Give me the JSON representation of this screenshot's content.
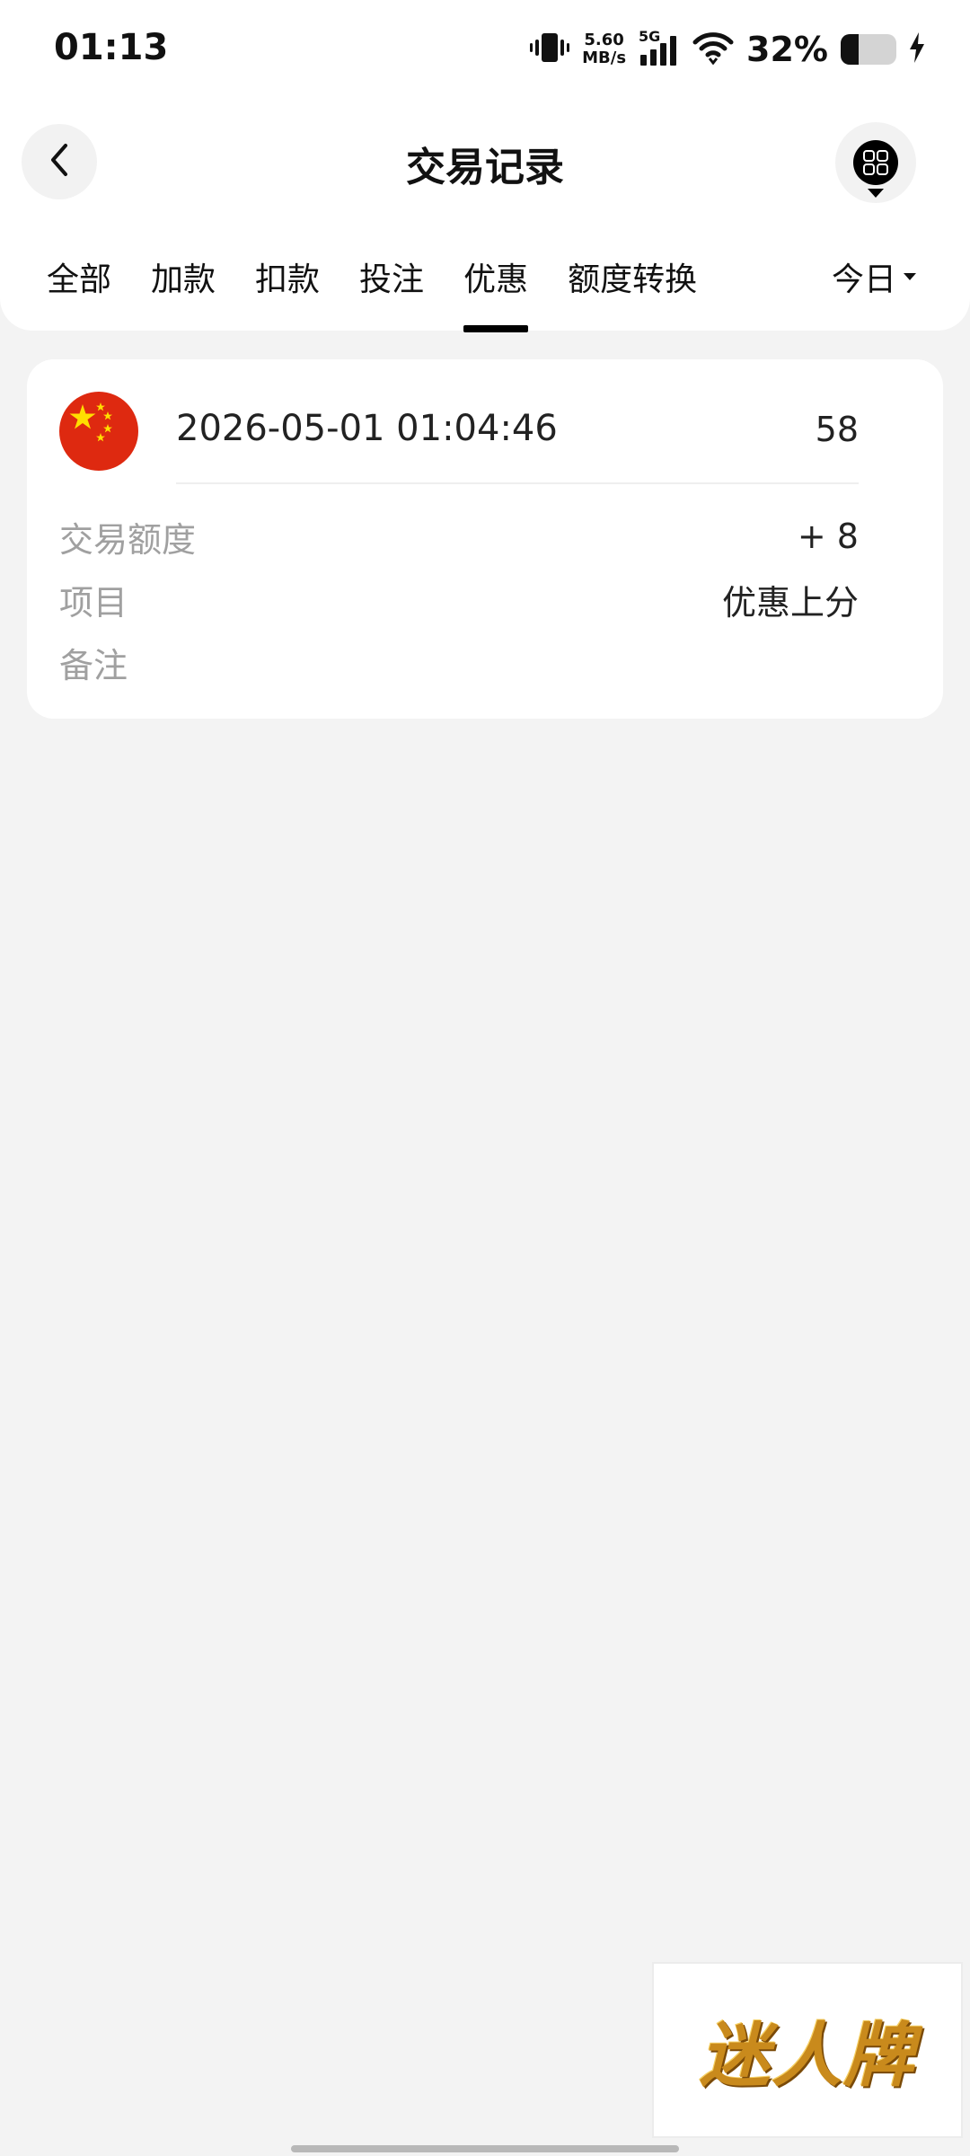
{
  "status_bar": {
    "time": "01:13",
    "net_speed_value": "5.60",
    "net_speed_unit": "MB/s",
    "network": "5G",
    "battery_percent": "32%",
    "battery_level": 0.32,
    "icons": [
      "vibrate-icon",
      "signal-icon",
      "wifi-icon",
      "battery-icon",
      "charging-icon"
    ]
  },
  "header": {
    "title": "交易记录",
    "back_icon": "chevron-left-icon",
    "menu_icon": "grid-menu-icon"
  },
  "tabs": {
    "items": [
      {
        "label": "全部"
      },
      {
        "label": "加款"
      },
      {
        "label": "扣款"
      },
      {
        "label": "投注"
      },
      {
        "label": "优惠"
      },
      {
        "label": "额度转换"
      }
    ],
    "active_index": 4,
    "date_filter": "今日"
  },
  "record": {
    "flag_icon": "china-flag-icon",
    "time": "2026-05-01 01:04:46",
    "id": "58",
    "amount_label": "交易额度",
    "amount_value": "+ 8",
    "item_label": "项目",
    "item_value": "优惠上分",
    "note_label": "备注",
    "note_value": ""
  },
  "watermark": {
    "text": "迷人牌"
  },
  "colors": {
    "background": "#f3f3f3",
    "card": "#ffffff",
    "accent": "#000000",
    "label_gray": "#a0a0a0",
    "flag_red": "#de2910",
    "flag_yellow": "#ffde00"
  }
}
